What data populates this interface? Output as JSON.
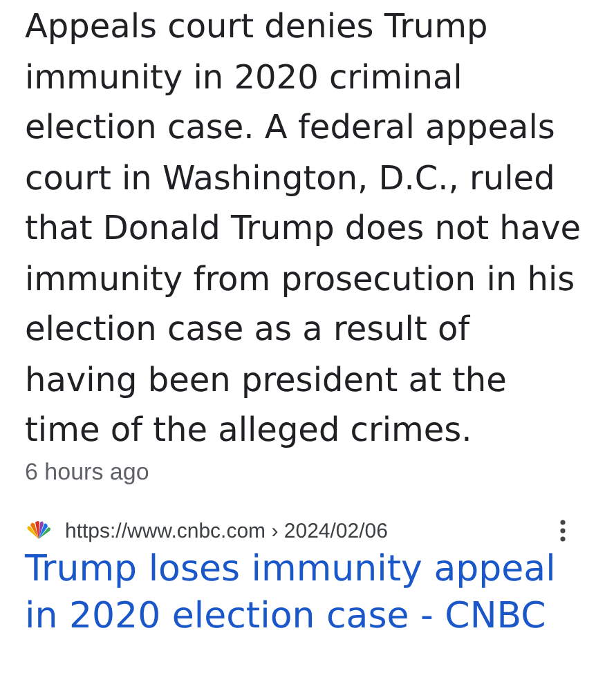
{
  "snippet": {
    "text": "Appeals court denies Trump immunity in 2020 criminal election case. A federal appeals court in Washington, D.C., ruled that Donald Trump does not have immunity from prosecution in his election case as a result of having been president at the time of the alleged crimes.",
    "time": "6 hours ago"
  },
  "result": {
    "url": "https://www.cnbc.com › 2024/02/06",
    "title": "Trump loses immunity appeal in 2020 election case - CNBC"
  }
}
